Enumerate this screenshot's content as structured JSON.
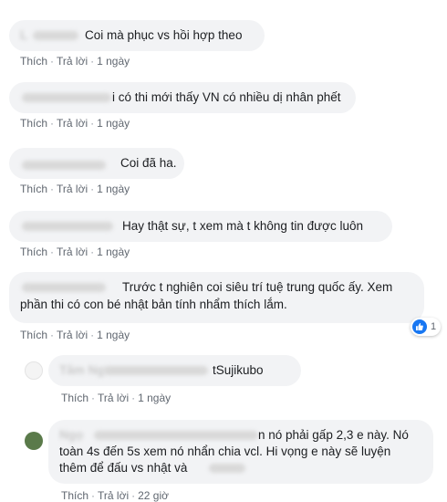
{
  "labels": {
    "like": "Thích",
    "reply": "Trả lời",
    "separator": "·"
  },
  "comments": [
    {
      "name": "L",
      "text": "Coi mà phục vs hồi hợp theo",
      "time": "1 ngày"
    },
    {
      "name": "N",
      "text": "i có thi mới thấy VN có nhiều dị nhân phết",
      "time": "1 ngày"
    },
    {
      "name": "N",
      "text": "Coi đã ha.",
      "time": "1 ngày"
    },
    {
      "name": "T",
      "text": "Hay thật sự, t xem mà t không tin được luôn",
      "time": "1 ngày"
    },
    {
      "name": "y",
      "text_line1": "Trước t nghiên coi siêu trí tuệ trung quốc ấy. Xem",
      "text_line2": "phần thi có con bé nhật bản tính nhẩm thích lắm.",
      "time": "1 ngày",
      "reaction_count": "1"
    }
  ],
  "replies": [
    {
      "name": "Tâm Ng",
      "text": "tSujikubo",
      "time": "1 ngày"
    },
    {
      "name": "Ngọ",
      "text_line1": "n nó phải gấp 2,3 e này. Nó",
      "text_line2": "toàn 4s đến 5s xem nó nhẩn chia vcl. Hi vọng e này sẽ luyện",
      "text_line3": "thêm để đấu vs nhật và",
      "time": "22 giờ"
    }
  ],
  "colors": {
    "bubble": "#f2f3f5",
    "meta": "#606770",
    "like_blue": "#1877f2"
  }
}
